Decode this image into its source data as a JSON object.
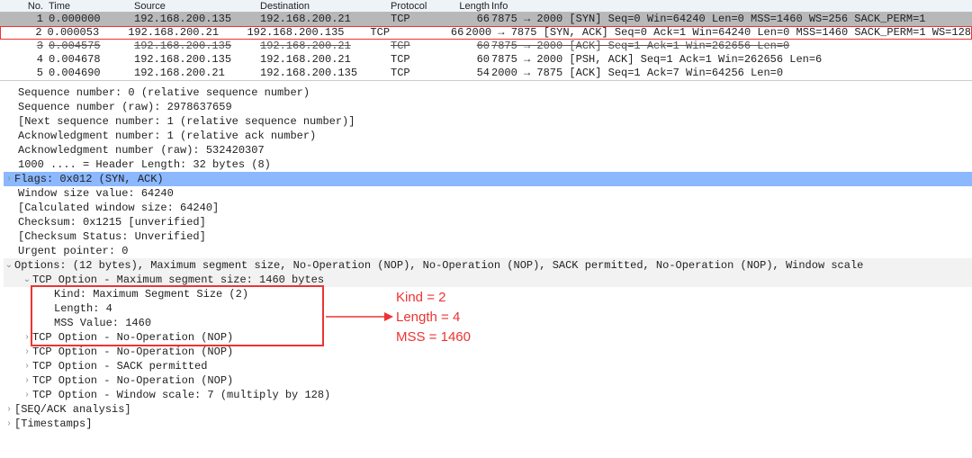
{
  "columns": {
    "no": "No.",
    "time": "Time",
    "source": "Source",
    "destination": "Destination",
    "protocol": "Protocol",
    "length": "Length",
    "info": "Info"
  },
  "packets": [
    {
      "no": "1",
      "time": "0.000000",
      "src": "192.168.200.135",
      "dst": "192.168.200.21",
      "proto": "TCP",
      "len": "66",
      "info": "7875 → 2000 [SYN] Seq=0 Win=64240 Len=0 MSS=1460 WS=256 SACK_PERM=1"
    },
    {
      "no": "2",
      "time": "0.000053",
      "src": "192.168.200.21",
      "dst": "192.168.200.135",
      "proto": "TCP",
      "len": "66",
      "info": "2000 → 7875 [SYN, ACK] Seq=0 Ack=1 Win=64240 Len=0 MSS=1460 SACK_PERM=1 WS=128"
    },
    {
      "no": "3",
      "time": "0.004575",
      "src": "192.168.200.135",
      "dst": "192.168.200.21",
      "proto": "TCP",
      "len": "60",
      "info": "7875 → 2000 [ACK] Seq=1 Ack=1 Win=262656 Len=0"
    },
    {
      "no": "4",
      "time": "0.004678",
      "src": "192.168.200.135",
      "dst": "192.168.200.21",
      "proto": "TCP",
      "len": "60",
      "info": "7875 → 2000 [PSH, ACK] Seq=1 Ack=1 Win=262656 Len=6"
    },
    {
      "no": "5",
      "time": "0.004690",
      "src": "192.168.200.21",
      "dst": "192.168.200.135",
      "proto": "TCP",
      "len": "54",
      "info": "2000 → 7875 [ACK] Seq=1 Ack=7 Win=64256 Len=0"
    }
  ],
  "details": {
    "seq_rel": "Sequence number: 0    (relative sequence number)",
    "seq_raw": "Sequence number (raw): 2978637659",
    "next_seq": "[Next sequence number: 1    (relative sequence number)]",
    "ack_rel": "Acknowledgment number: 1    (relative ack number)",
    "ack_raw": "Acknowledgment number (raw): 532420307",
    "hdrlen": "1000 .... = Header Length: 32 bytes (8)",
    "flags": "Flags: 0x012 (SYN, ACK)",
    "winsize": "Window size value: 64240",
    "calcwin": "[Calculated window size: 64240]",
    "checksum": "Checksum: 0x1215 [unverified]",
    "chkstat": "[Checksum Status: Unverified]",
    "urgent": "Urgent pointer: 0",
    "options": "Options: (12 bytes), Maximum segment size, No-Operation (NOP), No-Operation (NOP), SACK permitted, No-Operation (NOP), Window scale",
    "mss_opt": "TCP Option - Maximum segment size: 1460 bytes",
    "mss_kind": "Kind: Maximum Segment Size (2)",
    "mss_len": "Length: 4",
    "mss_val": "MSS Value: 1460",
    "nop1": "TCP Option - No-Operation (NOP)",
    "nop2": "TCP Option - No-Operation (NOP)",
    "sack": "TCP Option - SACK permitted",
    "nop3": "TCP Option - No-Operation (NOP)",
    "wscale": "TCP Option - Window scale: 7 (multiply by 128)",
    "seqack": "[SEQ/ACK analysis]",
    "timestamps": "[Timestamps]"
  },
  "annot": {
    "kind": "Kind = 2",
    "length": "Length = 4",
    "mss": "MSS = 1460"
  }
}
